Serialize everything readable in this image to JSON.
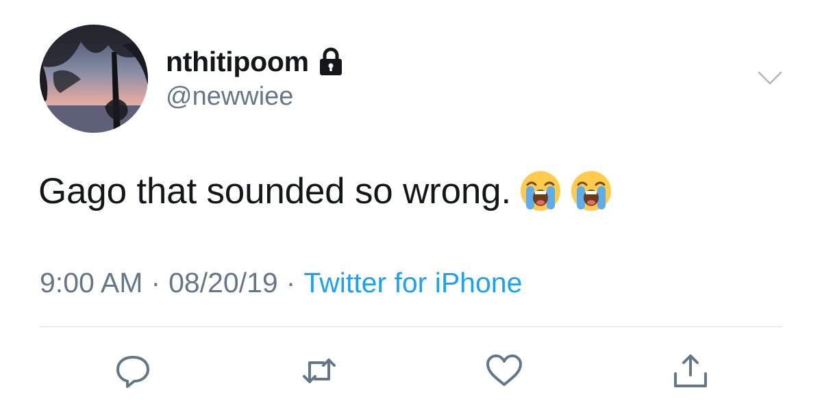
{
  "user": {
    "display_name": "nthitipoom",
    "handle": "@newwiee",
    "protected_icon": "lock-icon",
    "avatar": "sunset-trees-avatar"
  },
  "tweet": {
    "text": "Gago that sounded so wrong.",
    "emojis": [
      "loudly-crying-face",
      "loudly-crying-face"
    ]
  },
  "meta": {
    "time": "9:00 AM",
    "separator": "·",
    "date": "08/20/19",
    "source": "Twitter for iPhone"
  },
  "actions": [
    "reply-icon",
    "retweet-icon",
    "like-icon",
    "share-icon"
  ],
  "colors": {
    "text_primary": "#14171a",
    "text_secondary": "#657786",
    "link": "#1da1f2",
    "divider": "#d6dde3"
  }
}
